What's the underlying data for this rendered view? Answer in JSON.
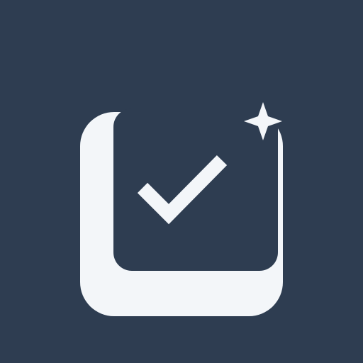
{
  "colors": {
    "background": "#2E3D51",
    "icon_light": "#F3F6F9",
    "icon_dark": "#2E3D51"
  },
  "icons": {
    "main": "checkbox-checked-icon",
    "accent": "sparkle-icon"
  }
}
